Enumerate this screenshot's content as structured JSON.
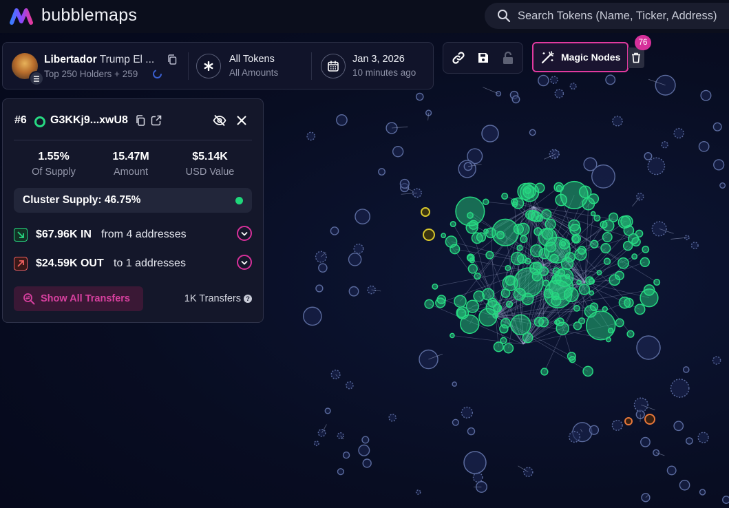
{
  "app": {
    "name": "bubblemaps",
    "brand_colors": [
      "#e13a9f",
      "#7a4bff",
      "#3b7bff"
    ]
  },
  "search": {
    "placeholder": "Search Tokens (Name, Ticker, Address)",
    "icon": "search-icon"
  },
  "token": {
    "name": "Libertador",
    "symbol": "Trump El ...",
    "holders": "Top 250 Holders + 259",
    "filter_title": "All Tokens",
    "filter_sub": "All Amounts",
    "date": "Jan 3, 2026",
    "updated": "10 minutes ago"
  },
  "toolbar": {
    "link_icon": "link-icon",
    "save_icon": "save-icon",
    "lock_icon": "lock-icon"
  },
  "magic": {
    "label": "Magic Nodes",
    "count": "76",
    "icon": "magic-wand-icon"
  },
  "detail": {
    "rank": "#6",
    "address": "G3KKj9...xwU8",
    "stats": [
      {
        "value": "1.55%",
        "label": "Of Supply"
      },
      {
        "value": "15.47M",
        "label": "Amount"
      },
      {
        "value": "$5.14K",
        "label": "USD Value"
      }
    ],
    "cluster_supply": "Cluster Supply: 46.75%",
    "in_amount": "$67.96K IN",
    "in_desc": "from 4 addresses",
    "out_amount": "$24.59K OUT",
    "out_desc": "to 1 addresses",
    "show_transfers": "Show All Transfers",
    "transfers_count": "1K Transfers"
  },
  "colors": {
    "cluster_green": "#27d982",
    "neutral_bubble": "#5b6b9e",
    "highlight_yellow": "#d8c72c",
    "highlight_orange": "#e8783a"
  }
}
